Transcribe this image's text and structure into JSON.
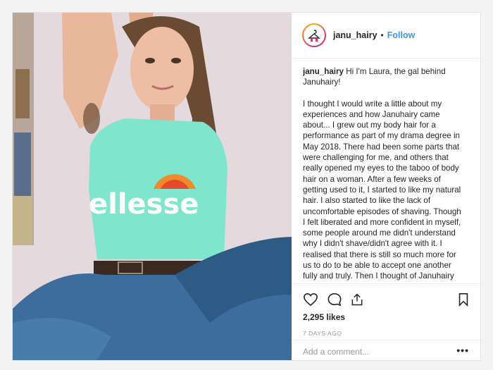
{
  "post": {
    "username": "janu_hairy",
    "separator": "•",
    "follow_label": "Follow",
    "caption_username": "janu_hairy",
    "caption_intro": " Hi I'm Laura, the gal behind Januhairy!",
    "caption_body": "I thought I would write a little about my experiences and how Januhairy came about... I grew out my body hair for a performance as part of my drama degree in May 2018. There had been some parts that were challenging for me, and others that really opened my eyes to the taboo of body hair on a woman. After a few weeks of getting used to it, I started to like my natural hair. I also started to like the lack of uncomfortable episodes of shaving. Though I felt liberated and more confident in myself, some people around me didn't understand why I didn't shave/didn't agree with it. I realised that there is still so much more for us to do to be able to accept one another fully and truly. Then I thought of Januhairy and thought I would try it out. It's",
    "likes": "2,295 likes",
    "date": "7 DAYS AGO",
    "comment_placeholder": "Add a comment...",
    "more_label": "•••"
  },
  "photo": {
    "shirt_brand": "ellesse"
  },
  "icons": {
    "like": "heart-icon",
    "comment": "comment-icon",
    "share": "share-icon",
    "save": "bookmark-icon",
    "avatar": "hanger-logo-icon"
  },
  "colors": {
    "follow": "#3897f0",
    "shirt": "#7fe5cc",
    "jeans": "#3d6d9c"
  }
}
